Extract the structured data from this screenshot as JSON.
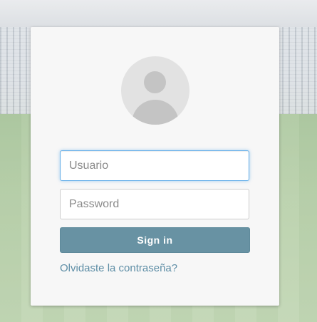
{
  "login": {
    "username": {
      "placeholder": "Usuario",
      "value": ""
    },
    "password": {
      "placeholder": "Password",
      "value": ""
    },
    "signin_label": "Sign in",
    "forgot_link": "Olvidaste la contraseña?"
  },
  "icons": {
    "avatar": "user-avatar-icon"
  },
  "colors": {
    "button_bg": "#6892a3",
    "link": "#5e8ea6",
    "focus_border": "#66afe9",
    "card_bg": "#f7f7f7"
  }
}
